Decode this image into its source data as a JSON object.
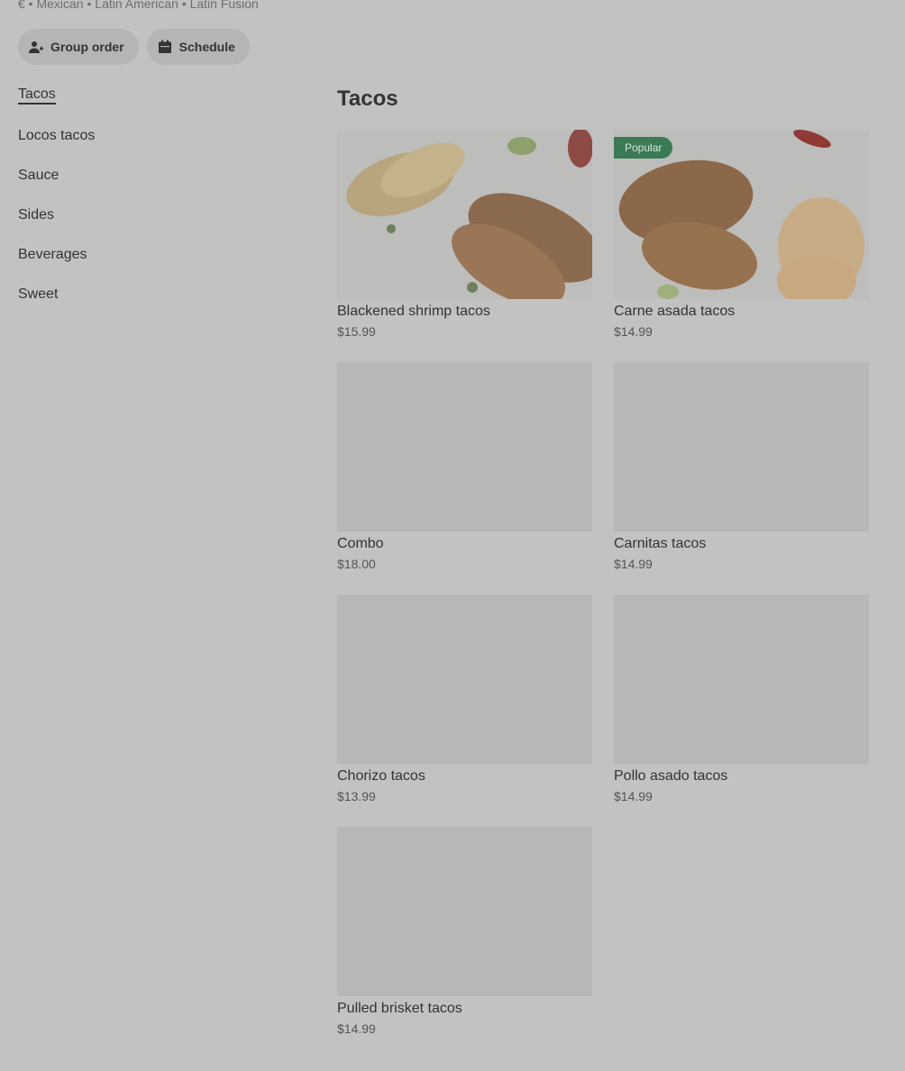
{
  "store": {
    "cuisine_line": "€ • Mexican • Latin American • Latin Fusion"
  },
  "actions": {
    "group_order_label": "Group order",
    "schedule_label": "Schedule",
    "group_order_icon": "person-add-icon",
    "schedule_icon": "calendar-icon"
  },
  "side_nav": {
    "items": [
      {
        "label": "Tacos",
        "active": true
      },
      {
        "label": "Locos tacos",
        "active": false
      },
      {
        "label": "Sauce",
        "active": false
      },
      {
        "label": "Sides",
        "active": false
      },
      {
        "label": "Beverages",
        "active": false
      },
      {
        "label": "Sweet",
        "active": false
      }
    ]
  },
  "section": {
    "title": "Tacos",
    "items": [
      {
        "name": "Blackened shrimp tacos",
        "price": "$15.99",
        "badge": "",
        "has_image": true
      },
      {
        "name": "Carne asada tacos",
        "price": "$14.99",
        "badge": "Popular",
        "has_image": true
      },
      {
        "name": "Combo",
        "price": "$18.00",
        "badge": "",
        "has_image": false
      },
      {
        "name": "Carnitas tacos",
        "price": "$14.99",
        "badge": "",
        "has_image": false
      },
      {
        "name": "Chorizo tacos",
        "price": "$13.99",
        "badge": "",
        "has_image": false
      },
      {
        "name": "Pollo asado tacos",
        "price": "$14.99",
        "badge": "",
        "has_image": false
      },
      {
        "name": "Pulled brisket tacos",
        "price": "$14.99",
        "badge": "",
        "has_image": false
      }
    ]
  },
  "colors": {
    "overlay_background": "#c2c2c2",
    "badge": "#3a7b55",
    "text": "#333333"
  }
}
